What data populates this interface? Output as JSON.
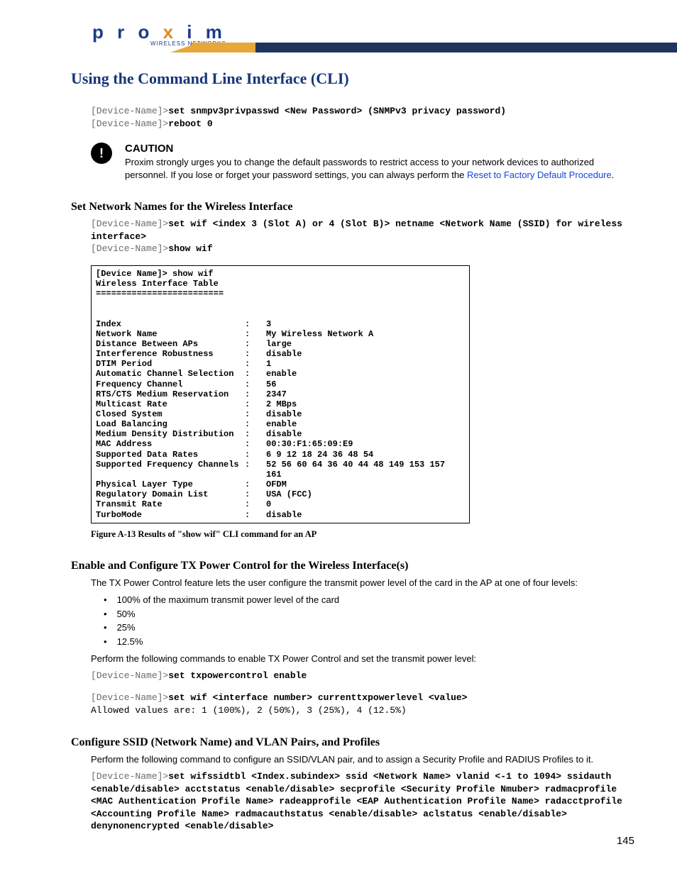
{
  "brand": {
    "name": "proxim",
    "sub": "WIRELESS NETWORKS"
  },
  "title": "Using the Command Line Interface (CLI)",
  "snmp_block": {
    "p1": "[Device-Name]>",
    "cmd1": "set snmpv3privpasswd <New Password> (SNMPv3 privacy password)",
    "p2": "[Device-Name]>",
    "cmd2": "reboot 0"
  },
  "caution": {
    "heading": "CAUTION",
    "text_before": "Proxim strongly urges you to change the default passwords to restrict access to your network devices to authorized personnel. If you lose or forget your password settings, you can always perform the ",
    "link": "Reset to Factory Default Procedure",
    "text_after": "."
  },
  "set_net": {
    "heading": "Set Network Names for the Wireless Interface",
    "p1": "[Device-Name]>",
    "cmd1": "set wif <index 3 (Slot A) or 4 (Slot B)> netname <Network Name (SSID) for wireless interface>",
    "p2": "[Device-Name]>",
    "cmd2": "show wif"
  },
  "wif_header": {
    "l1": "[Device Name]> show wif",
    "l2": "Wireless Interface Table",
    "l3": "========================="
  },
  "wif_rows": [
    {
      "k": "Index",
      "v": "3"
    },
    {
      "k": "Network Name",
      "v": "My Wireless Network A"
    },
    {
      "k": "Distance Between APs",
      "v": "large"
    },
    {
      "k": "Interference Robustness",
      "v": "disable"
    },
    {
      "k": "DTIM Period",
      "v": "1"
    },
    {
      "k": "Automatic Channel Selection",
      "v": "enable"
    },
    {
      "k": "Frequency Channel",
      "v": "56"
    },
    {
      "k": "RTS/CTS Medium Reservation",
      "v": "2347"
    },
    {
      "k": "Multicast Rate",
      "v": "2 MBps"
    },
    {
      "k": "Closed System",
      "v": "disable"
    },
    {
      "k": "Load Balancing",
      "v": "enable"
    },
    {
      "k": "Medium Density Distribution",
      "v": "disable"
    },
    {
      "k": "MAC Address",
      "v": "00:30:F1:65:09:E9"
    },
    {
      "k": "Supported Data Rates",
      "v": "6 9 12 18 24 36 48 54"
    },
    {
      "k": "Supported Frequency Channels",
      "v": "52 56 60 64 36 40 44 48 149 153 157 161"
    },
    {
      "k": "Physical Layer Type",
      "v": "OFDM"
    },
    {
      "k": "Regulatory Domain List",
      "v": "USA (FCC)"
    },
    {
      "k": "Transmit Rate",
      "v": "0"
    },
    {
      "k": "TurboMode",
      "v": "disable"
    }
  ],
  "fig_caption": "Figure A-13   Results of \"show wif\" CLI command for an AP",
  "txpower": {
    "heading": "Enable and Configure TX Power Control for the Wireless Interface(s)",
    "intro": "The TX Power Control feature lets the user configure the transmit power level of the card in the AP at one of four levels:",
    "bullets": [
      "100% of the maximum transmit power level of the card",
      "50%",
      "25%",
      "12.5%"
    ],
    "perform": "Perform the following commands to enable TX Power Control and set the transmit power level:",
    "p1": "[Device-Name]>",
    "cmd1": "set txpowercontrol enable",
    "p2": "[Device-Name]>",
    "cmd2": "set wif <interface number> currenttxpowerlevel <value>",
    "allowed": "Allowed values are: 1 (100%), 2 (50%), 3 (25%), 4 (12.5%)"
  },
  "ssid": {
    "heading": "Configure SSID (Network Name) and VLAN Pairs, and Profiles",
    "intro": "Perform the following command to configure an SSID/VLAN pair, and to assign a Security Profile and RADIUS Profiles to it.",
    "p1": "[Device-Name]>",
    "cmd1": "set wifssidtbl <Index.subindex> ssid <Network Name> vlanid <-1 to 1094> ssidauth <enable/disable> acctstatus <enable/disable> secprofile <Security Profile Nmuber> radmacprofile <MAC Authentication Profile Name> radeapprofile <EAP Authentication Profile Name> radacctprofile <Accounting Profile Name> radmacauthstatus <enable/disable> aclstatus <enable/disable> denynonencrypted <enable/disable>"
  },
  "page_number": "145"
}
